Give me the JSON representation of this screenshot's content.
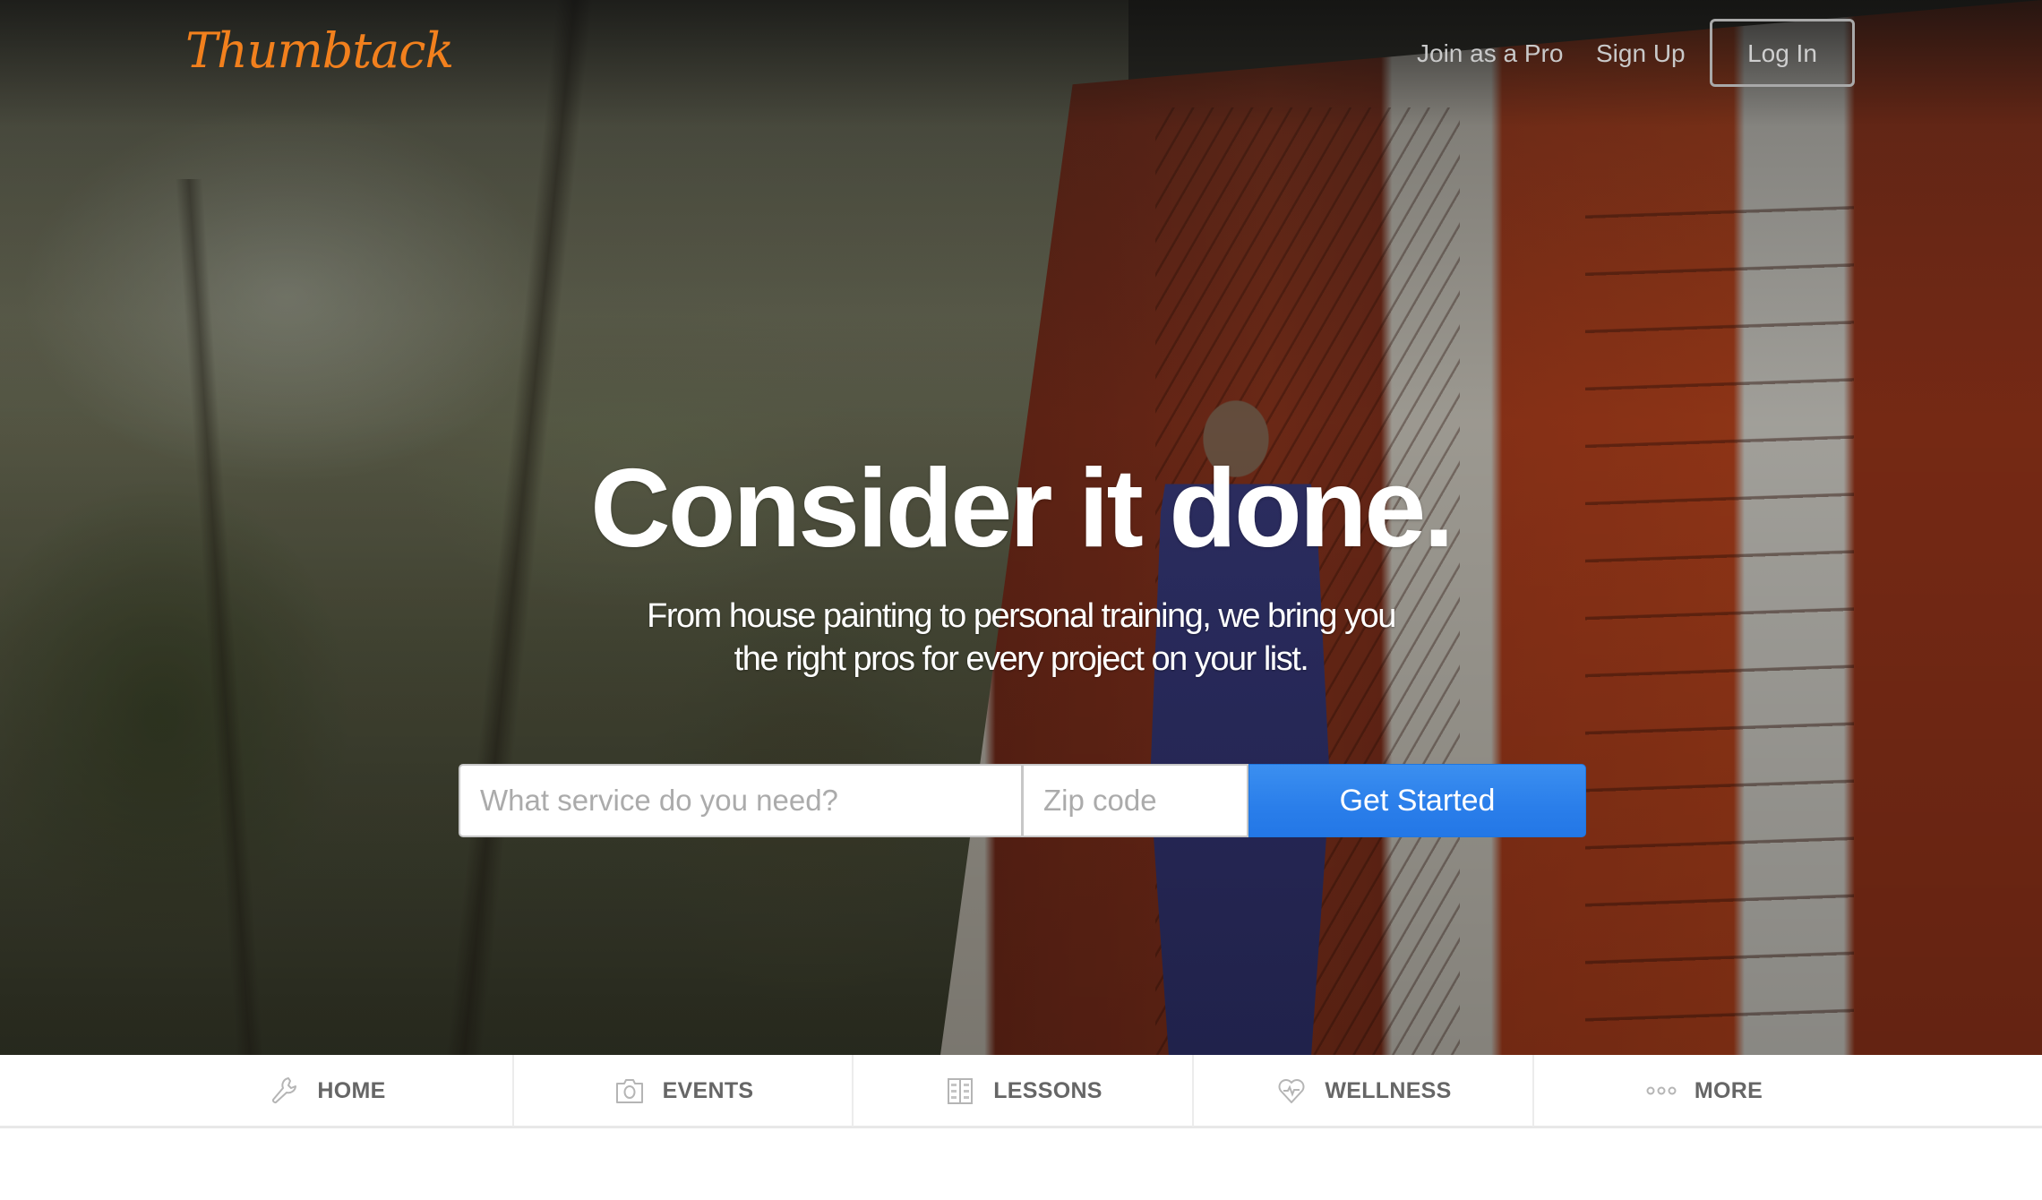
{
  "header": {
    "logo": "Thumbtack",
    "links": [
      {
        "label": "Join as a Pro"
      },
      {
        "label": "Sign Up"
      }
    ],
    "login_label": "Log In"
  },
  "hero": {
    "headline": "Consider it done.",
    "subtitle_line1": "From house painting to personal training, we bring you",
    "subtitle_line2": "the right pros for every project on your list."
  },
  "search": {
    "service_placeholder": "What service do you need?",
    "service_value": "",
    "zip_placeholder": "Zip code",
    "zip_value": "",
    "submit_label": "Get Started"
  },
  "categories": [
    {
      "label": "HOME",
      "icon": "wrench-icon"
    },
    {
      "label": "EVENTS",
      "icon": "camera-icon"
    },
    {
      "label": "LESSONS",
      "icon": "book-icon"
    },
    {
      "label": "WELLNESS",
      "icon": "heart-pulse-icon"
    },
    {
      "label": "MORE",
      "icon": "more-dots-icon"
    }
  ],
  "colors": {
    "brand": "#f2801d",
    "cta": "#2a7eea",
    "category_text": "#666666"
  }
}
